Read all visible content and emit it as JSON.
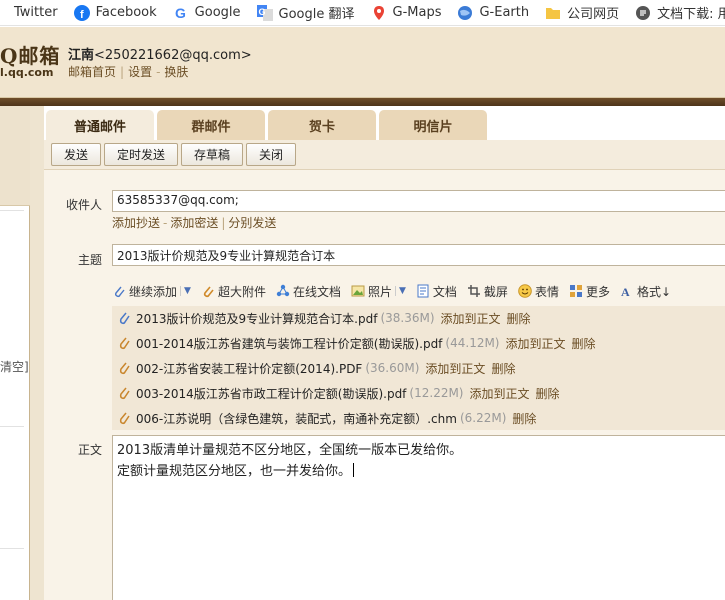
{
  "bookmarks": [
    {
      "label": "Twitter",
      "icon": "twitter-icon"
    },
    {
      "label": "Facebook",
      "icon": "facebook-icon"
    },
    {
      "label": "Google",
      "icon": "google-icon"
    },
    {
      "label": "Google 翻译",
      "icon": "google-translate-icon"
    },
    {
      "label": "G-Maps",
      "icon": "google-maps-icon"
    },
    {
      "label": "G-Earth",
      "icon": "google-earth-icon"
    },
    {
      "label": "公司网页",
      "icon": "folder-icon"
    },
    {
      "label": "文档下载: 用户",
      "icon": "download-page-icon"
    }
  ],
  "header": {
    "logo_text": "Q邮箱",
    "logo_domain": "l.qq.com",
    "user_name": "江南",
    "user_email": "<250221662@qq.com>",
    "links": [
      "邮箱首页",
      "设置",
      "换肤"
    ]
  },
  "left": {
    "clear_text": "清空]"
  },
  "tabs": [
    "普通邮件",
    "群邮件",
    "贺卡",
    "明信片"
  ],
  "toolbar": {
    "send": "发送",
    "timed_send": "定时发送",
    "save_draft": "存草稿",
    "close": "关闭"
  },
  "compose": {
    "to_label": "收件人",
    "to_value": "63585337@qq.com;",
    "cc_links": [
      "添加抄送",
      "添加密送",
      "分别发送"
    ],
    "subject_label": "主题",
    "subject_value": "2013版计价规范及9专业计算规范合订本",
    "body_label": "正文",
    "body_lines": [
      "2013版清单计量规范不区分地区，全国统一版本已发给你。",
      "定额计量规范区分地区，也一并发给你。"
    ]
  },
  "attach_tools": [
    {
      "label": "继续添加",
      "icon": "paperclip-icon",
      "dropdown": true
    },
    {
      "label": "超大附件",
      "icon": "large-attachment-icon",
      "dropdown": false
    },
    {
      "label": "在线文档",
      "icon": "online-doc-icon",
      "dropdown": false
    },
    {
      "label": "照片",
      "icon": "photo-icon",
      "dropdown": true
    },
    {
      "label": "文档",
      "icon": "document-icon",
      "dropdown": false
    },
    {
      "label": "截屏",
      "icon": "screenshot-icon",
      "dropdown": false
    },
    {
      "label": "表情",
      "icon": "emoji-icon",
      "dropdown": false
    },
    {
      "label": "更多",
      "icon": "more-apps-icon",
      "dropdown": false
    },
    {
      "label": "格式↓",
      "icon": "format-icon",
      "dropdown": false
    }
  ],
  "attachments": [
    {
      "name": "2013版计价规范及9专业计算规范合订本.pdf",
      "size": "(38.36M)",
      "add": "添加到正文",
      "del": "删除",
      "icon_color": "#4a78c8"
    },
    {
      "name": "001-2014版江苏省建筑与装饰工程计价定额(勘误版).pdf",
      "size": "(44.12M)",
      "add": "添加到正文",
      "del": "删除",
      "icon_color": "#c9862d"
    },
    {
      "name": "002-江苏省安装工程计价定额(2014).PDF",
      "size": "(36.60M)",
      "add": "添加到正文",
      "del": "删除",
      "icon_color": "#c9862d"
    },
    {
      "name": "003-2014版江苏省市政工程计价定额(勘误版).pdf",
      "size": "(12.22M)",
      "add": "添加到正文",
      "del": "删除",
      "icon_color": "#c9862d"
    },
    {
      "name": "006-江苏说明（含绿色建筑，装配式，南通补充定额）.chm",
      "size": "(6.22M)",
      "add": "",
      "del": "删除",
      "icon_color": "#c9862d"
    }
  ]
}
